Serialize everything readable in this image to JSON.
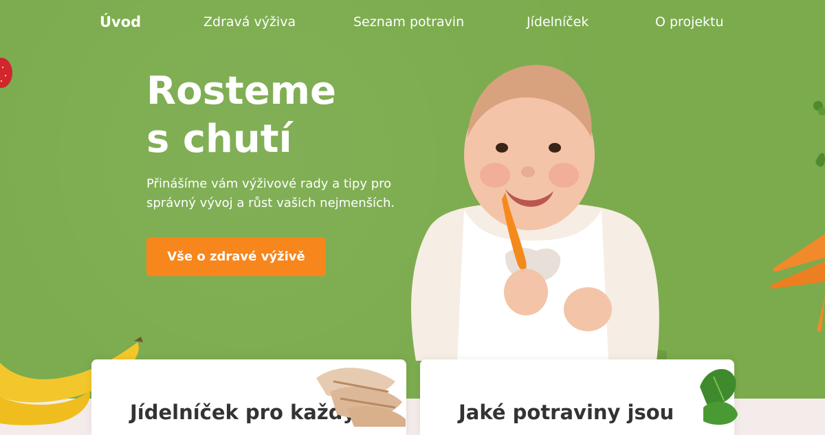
{
  "nav": {
    "items": [
      "Úvod",
      "Zdravá výživa",
      "Seznam potravin",
      "Jídelníček",
      "O projektu"
    ]
  },
  "hero": {
    "title_line1": "Rosteme",
    "title_line2": "s chutí",
    "subtitle": "Přinášíme vám výživové rady a tipy pro správný vývoj a růst vašich nejmenších.",
    "cta_label": "Vše o zdravé výživě"
  },
  "cards": [
    {
      "title": "Jídelníček pro každý"
    },
    {
      "title": "Jaké potraviny jsou"
    }
  ],
  "colors": {
    "hero_background": "#7bab4d",
    "cta": "#f7861c",
    "page_background": "#f4ecea"
  }
}
